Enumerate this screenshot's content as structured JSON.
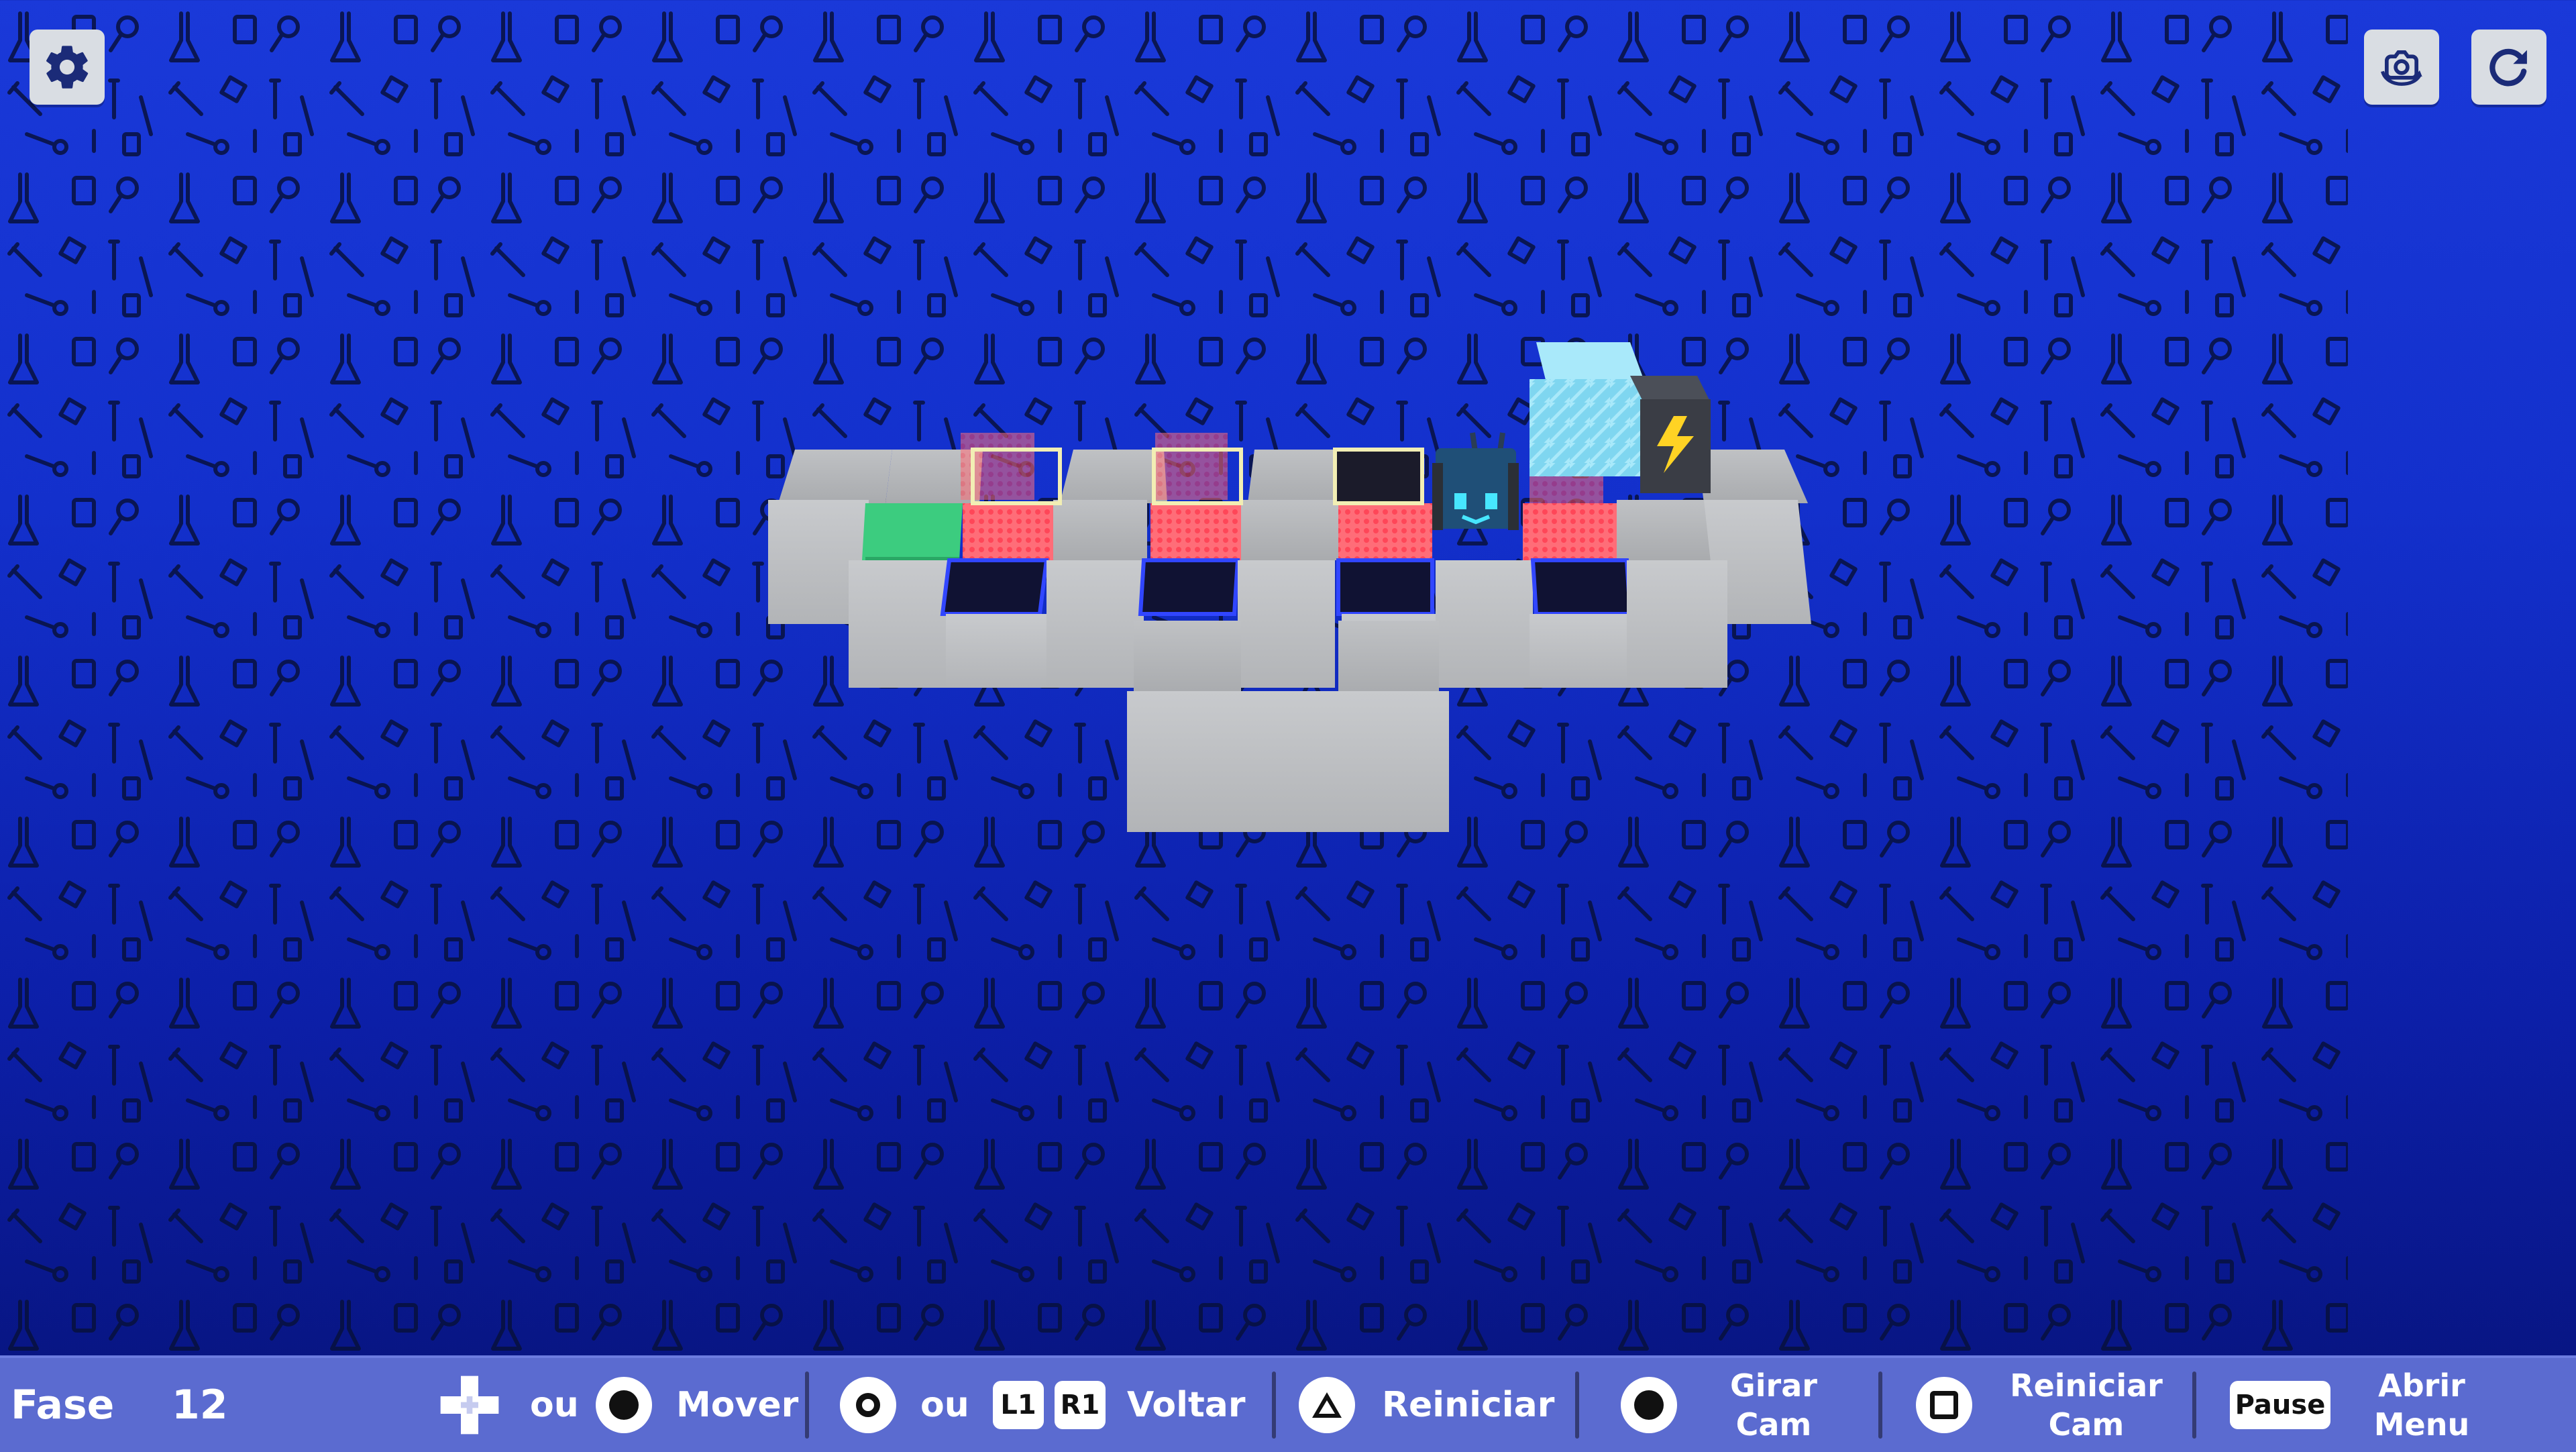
{
  "top_bar": {
    "settings_icon": "gear-icon",
    "camera_icon": "camera-rotate-icon",
    "restart_icon": "restart-icon"
  },
  "hud": {
    "level_label": "Fase",
    "level_number": "12",
    "or_1": "ou",
    "move_label": "Mover",
    "or_2": "ou",
    "l1_key": "L1",
    "r1_key": "R1",
    "undo_label": "Voltar",
    "restart_label": "Reiniciar",
    "rotate_cam_label": "Girar Cam",
    "reset_cam_label": "Reiniciar Cam",
    "pause_key": "Pause",
    "open_menu_label": "Abrir Menu"
  },
  "colors": {
    "background": "#1330cc",
    "hud_bar": "#5b6bd0",
    "tile": "#c9cbcd",
    "goal_tile": "#34c07a",
    "pressure_plate": "#ff5a6a",
    "pit": "#101233",
    "ice_block": "#7fd6f0",
    "battery": "#3a3d45",
    "robot": "#1f4f77"
  },
  "scene": {
    "player": "robot",
    "objects": [
      "goal-tile",
      "red-pressure-plate",
      "dark-pit",
      "ice-block",
      "battery-block"
    ]
  }
}
